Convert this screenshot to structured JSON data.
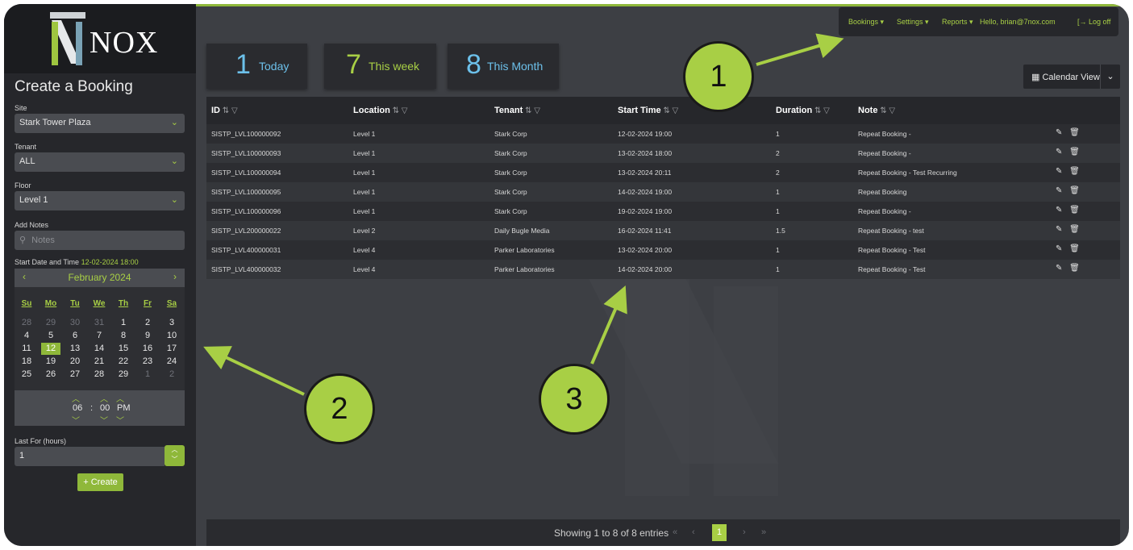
{
  "brand": {
    "name": "NOX"
  },
  "sidebar": {
    "title": "Create a Booking",
    "site_label": "Site",
    "site_value": "Stark Tower Plaza",
    "tenant_label": "Tenant",
    "tenant_value": "ALL",
    "floor_label": "Floor",
    "floor_value": "Level 1",
    "notes_label": "Add Notes",
    "notes_placeholder": "Notes",
    "datetime_label": "Start Date and Time",
    "datetime_value": "12-02-2024 18:00",
    "calendar": {
      "month": "February  2024",
      "prev": "‹",
      "next": "›",
      "weekdays": [
        "Su",
        "Mo",
        "Tu",
        "We",
        "Th",
        "Fr",
        "Sa"
      ],
      "weeks": [
        [
          "28",
          "29",
          "30",
          "31",
          "1",
          "2",
          "3"
        ],
        [
          "4",
          "5",
          "6",
          "7",
          "8",
          "9",
          "10"
        ],
        [
          "11",
          "12",
          "13",
          "14",
          "15",
          "16",
          "17"
        ],
        [
          "18",
          "19",
          "20",
          "21",
          "22",
          "23",
          "24"
        ],
        [
          "25",
          "26",
          "27",
          "28",
          "29",
          "1",
          "2"
        ]
      ],
      "selected_day": "12"
    },
    "time": {
      "hour": "06",
      "sep": ":",
      "minute": "00",
      "ampm": "PM"
    },
    "lastfor_label": "Last For (hours)",
    "lastfor_value": "1",
    "create_label": "+ Create"
  },
  "topmenu": {
    "bookings": "Bookings ▾",
    "settings": "Settings ▾",
    "reports": "Reports ▾",
    "hello": "Hello, brian@7nox.com",
    "logoff": "[→ Log off"
  },
  "stats": [
    {
      "num": "1",
      "label": "Today"
    },
    {
      "num": "7",
      "label": "This week"
    },
    {
      "num": "8",
      "label": "This Month"
    }
  ],
  "calendar_view": {
    "label": "Calendar View",
    "icon": "calendar-icon"
  },
  "table": {
    "columns": [
      "ID",
      "Location",
      "Tenant",
      "Start Time",
      "Duration",
      "Note"
    ],
    "rows": [
      [
        "SISTP_LVL100000092",
        "Level 1",
        "Stark Corp",
        "12-02-2024 19:00",
        "1",
        "Repeat Booking -"
      ],
      [
        "SISTP_LVL100000093",
        "Level 1",
        "Stark Corp",
        "13-02-2024 18:00",
        "2",
        "Repeat Booking -"
      ],
      [
        "SISTP_LVL100000094",
        "Level 1",
        "Stark Corp",
        "13-02-2024 20:11",
        "2",
        "Repeat Booking - Test Recurring"
      ],
      [
        "SISTP_LVL100000095",
        "Level 1",
        "Stark Corp",
        "14-02-2024 19:00",
        "1",
        "Repeat Booking"
      ],
      [
        "SISTP_LVL100000096",
        "Level 1",
        "Stark Corp",
        "19-02-2024 19:00",
        "1",
        "Repeat Booking -"
      ],
      [
        "SISTP_LVL200000022",
        "Level 2",
        "Daily Bugle Media",
        "16-02-2024 11:41",
        "1.5",
        "Repeat Booking - test"
      ],
      [
        "SISTP_LVL400000031",
        "Level 4",
        "Parker Laboratories",
        "13-02-2024 20:00",
        "1",
        "Repeat Booking - Test"
      ],
      [
        "SISTP_LVL400000032",
        "Level 4",
        "Parker Laboratories",
        "14-02-2024 20:00",
        "1",
        "Repeat Booking - Test"
      ]
    ]
  },
  "footer": {
    "showing": "Showing 1 to 8 of 8 entries",
    "first": "«",
    "prev": "‹",
    "current": "1",
    "next": "›",
    "last": "»"
  },
  "callouts": [
    "1",
    "2",
    "3"
  ],
  "colors": {
    "accent": "#a8cf45",
    "stat_blue": "#6cc0ea",
    "background": "#3d3f44",
    "sidebar": "#26272b"
  }
}
